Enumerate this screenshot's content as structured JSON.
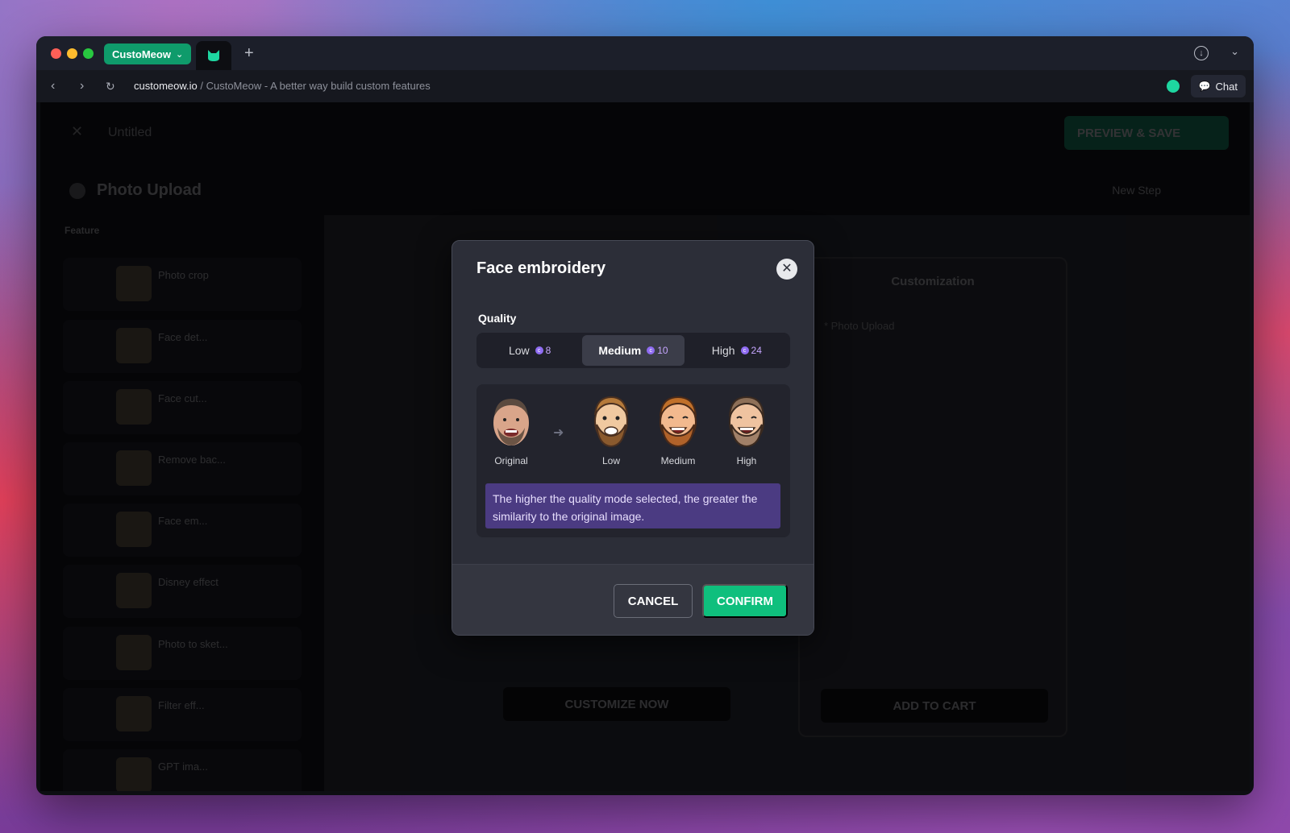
{
  "browser": {
    "profile_label": "CustoMeow",
    "tab_icon": "cat-icon",
    "new_tab_symbol": "+",
    "url_domain": "customeow.io",
    "url_rest": " / CustoMeow - A better way build custom features",
    "chat_label": "Chat"
  },
  "app": {
    "close_symbol": "✕",
    "document_title": "Untitled",
    "preview_save_label": "PREVIEW & SAVE",
    "step_title": "Photo Upload",
    "new_step_label": "New Step",
    "feature_heading": "Feature",
    "features": [
      {
        "name": "Photo crop"
      },
      {
        "name": "Face det..."
      },
      {
        "name": "Face cut..."
      },
      {
        "name": "Remove bac..."
      },
      {
        "name": "Face em..."
      },
      {
        "name": "Disney effect"
      },
      {
        "name": "Photo to sket..."
      },
      {
        "name": "Filter eff..."
      },
      {
        "name": "GPT ima..."
      }
    ],
    "customization_title": "Customization",
    "photo_upload_label": "* Photo Upload",
    "add_to_cart_label": "ADD TO CART",
    "customize_now_label": "CUSTOMIZE NOW"
  },
  "modal": {
    "title": "Face embroidery",
    "close_symbol": "✕",
    "quality_label": "Quality",
    "options": [
      {
        "label": "Low",
        "cost": "8",
        "active": false
      },
      {
        "label": "Medium",
        "cost": "10",
        "active": true
      },
      {
        "label": "High",
        "cost": "24",
        "active": false
      }
    ],
    "preview_labels": [
      "Original",
      "Low",
      "Medium",
      "High"
    ],
    "arrow_symbol": "➜",
    "info_text": "The higher the quality mode selected, the greater the similarity to the original image.",
    "cancel_label": "CANCEL",
    "confirm_label": "CONFIRM"
  },
  "colors": {
    "accent_green": "#0fbf7d",
    "info_purple": "#4b3b82",
    "coin_purple": "#8f6cf2"
  }
}
